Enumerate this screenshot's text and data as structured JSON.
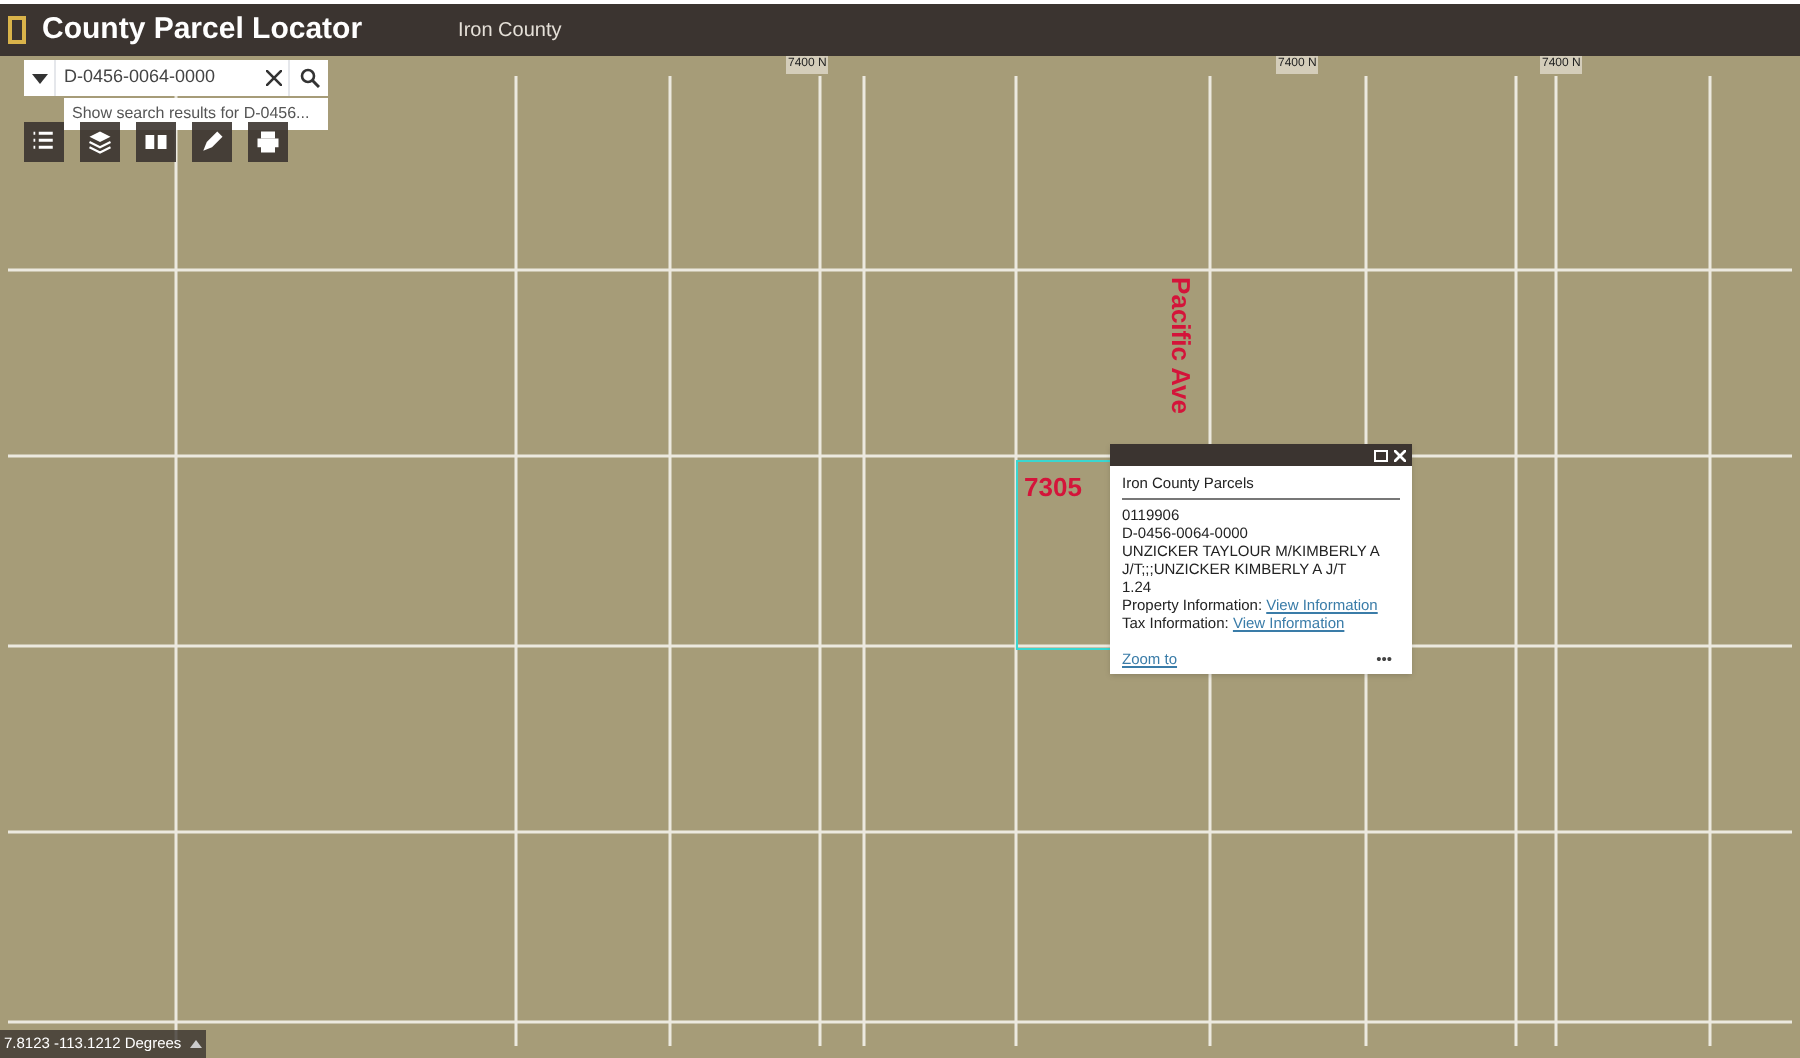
{
  "header": {
    "title": "County Parcel Locator",
    "subtitle": "Iron County"
  },
  "search": {
    "value": "D-0456-0064-0000",
    "suggestion": "Show search results for D-0456..."
  },
  "toolbar": [
    {
      "kind": "list"
    },
    {
      "kind": "layers"
    },
    {
      "kind": "grid"
    },
    {
      "kind": "edit"
    },
    {
      "kind": "print"
    }
  ],
  "map": {
    "road_labels": [
      {
        "text": "7400 N"
      },
      {
        "text": "7400 N"
      },
      {
        "text": "7400 N"
      }
    ],
    "street_label": "Pacific Ave",
    "parcel_label": "7305"
  },
  "popup": {
    "title": "Iron County Parcels",
    "lines": [
      "0119906",
      "D-0456-0064-0000",
      "UNZICKER TAYLOUR M/KIMBERLY A J/T;;;UNZICKER KIMBERLY A J/T",
      "1.24"
    ],
    "links": [
      {
        "label": "Property Information:",
        "link": "View Information"
      },
      {
        "label": "Tax Information:",
        "link": "View Information"
      }
    ],
    "zoom": "Zoom to",
    "more": "•••"
  },
  "coordinates": "7.8123 -113.1212 Degrees"
}
